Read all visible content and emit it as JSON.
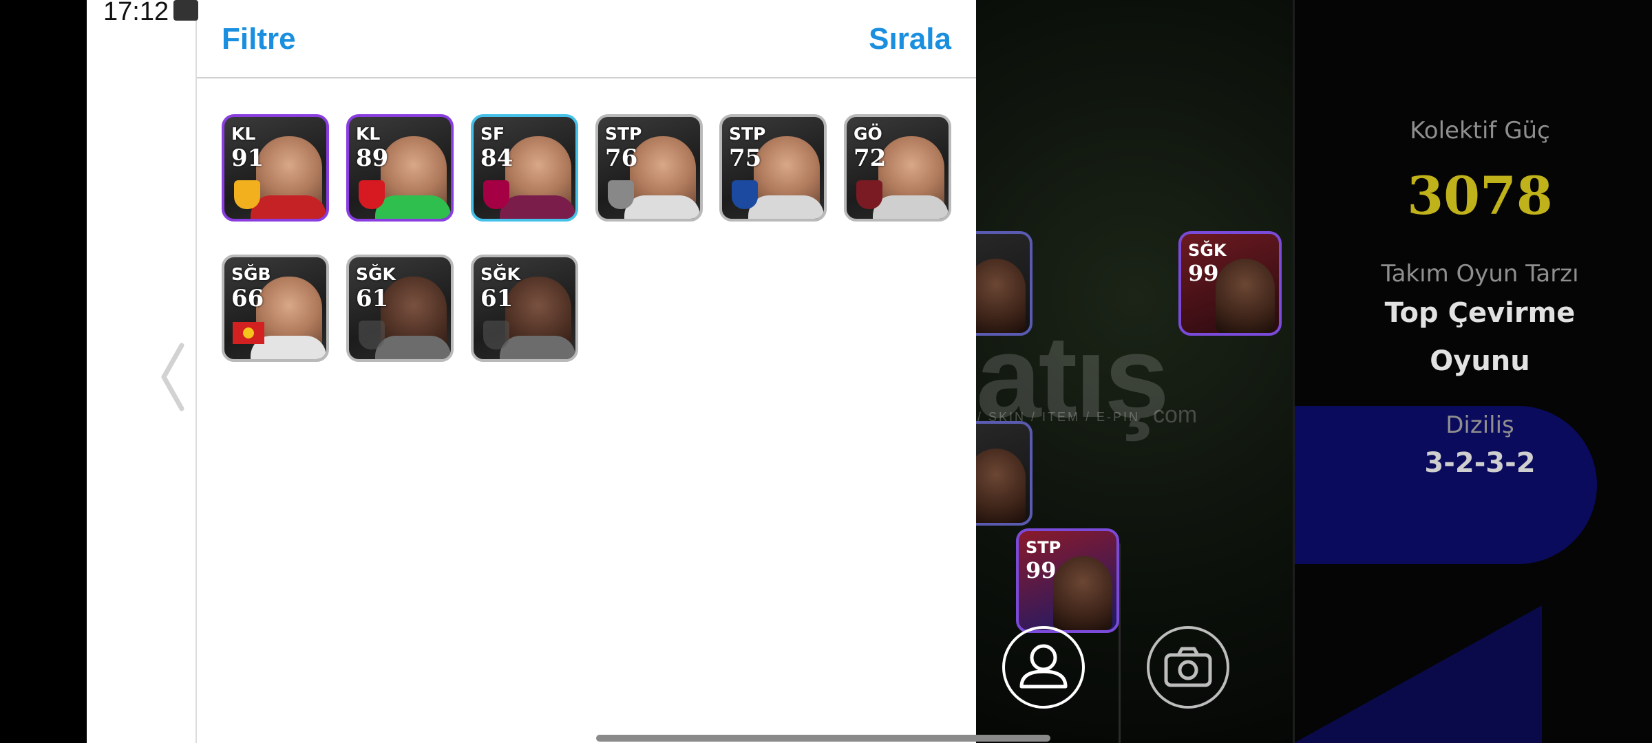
{
  "status": {
    "time": "17:12"
  },
  "panel": {
    "filter_label": "Filtre",
    "sort_label": "Sırala"
  },
  "cards": [
    {
      "position": "KL",
      "rating": "91",
      "frame": "purple",
      "shirt_color": "#c42224",
      "badge": "kayserispor-icon",
      "badge_color": "#f2b01e"
    },
    {
      "position": "KL",
      "rating": "89",
      "frame": "purple",
      "shirt_color": "#2fbf4f",
      "badge": "galatasaray-icon",
      "badge_color": "#d71921"
    },
    {
      "position": "SF",
      "rating": "84",
      "frame": "blue",
      "shirt_color": "#7a1d4a",
      "badge": "barcelona-icon",
      "badge_color": "#a50044"
    },
    {
      "position": "STP",
      "rating": "76",
      "frame": "gray",
      "shirt_color": "#dddddd",
      "badge": "club-crest-icon",
      "badge_color": "#888888"
    },
    {
      "position": "STP",
      "rating": "75",
      "frame": "gray",
      "shirt_color": "#d8d8d8",
      "badge": "porto-icon",
      "badge_color": "#1b4aa0"
    },
    {
      "position": "GÖ",
      "rating": "72",
      "frame": "gray",
      "shirt_color": "#cfcfcf",
      "badge": "salernitana-icon",
      "badge_color": "#7a1a22"
    },
    {
      "position": "SĞB",
      "rating": "66",
      "frame": "gray",
      "shirt_color": "#e4e4e4",
      "badge": "kyrgyzstan-flag-icon",
      "badge_color": "#d32020"
    },
    {
      "position": "SĞK",
      "rating": "61",
      "frame": "gray",
      "shirt_color": "#6c6c6c",
      "badge": "default-shield-icon",
      "badge_color": "#555555"
    },
    {
      "position": "SĞK",
      "rating": "61",
      "frame": "gray",
      "shirt_color": "#6c6c6c",
      "badge": "default-shield-icon",
      "badge_color": "#555555"
    }
  ],
  "field": {
    "watermark": "atış",
    "watermark_sub": "/ SKIN / ITEM / E-PIN",
    "watermark_domain": "com",
    "cards": [
      {
        "position": "SĞK",
        "rating": "99"
      },
      {
        "position": "STP",
        "rating": "99"
      }
    ]
  },
  "team": {
    "power_label": "Kolektif Güç",
    "power_value": "3078",
    "style_label": "Takım Oyun Tarzı",
    "style_line1": "Top Çevirme",
    "style_line2": "Oyunu",
    "formation_label": "Diziliş",
    "formation_value": "3-2-3-2"
  },
  "colors": {
    "accent": "#1a8fe0",
    "power": "#c0b21a"
  }
}
